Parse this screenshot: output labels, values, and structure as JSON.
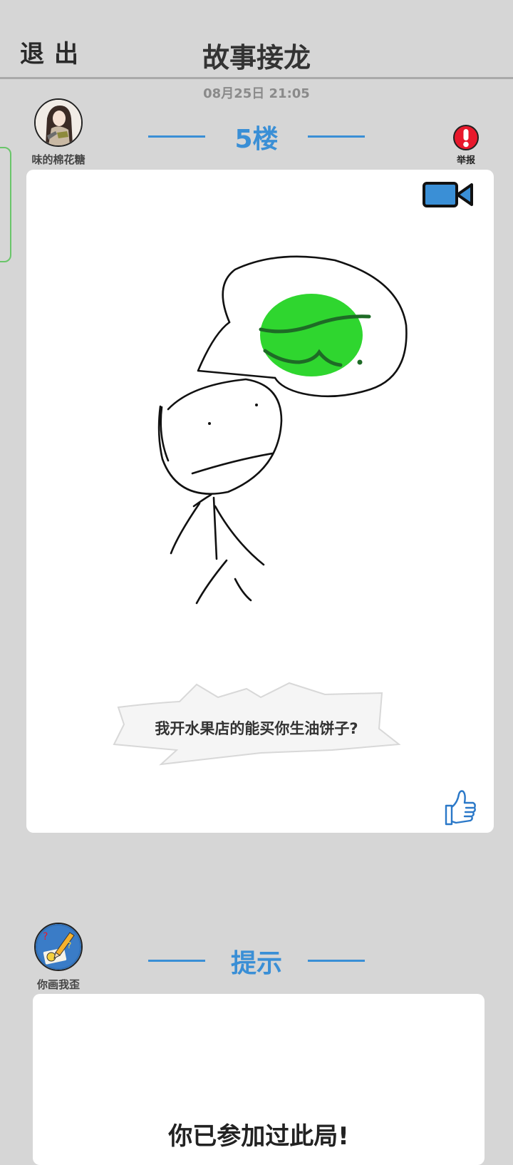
{
  "header": {
    "exit_label": "退出",
    "title": "故事接龙"
  },
  "post": {
    "time": "08月25日  21:05",
    "author_name": "味的棉花糖",
    "floor_label": "5楼",
    "report_label": "举报",
    "caption": "我开水果店的能买你生油饼子?"
  },
  "hint": {
    "author_name": "你画我歪",
    "label": "提示",
    "message": "你已参加过此局!"
  },
  "icons": {
    "report": "exclamation-circle-icon",
    "video": "video-camera-icon",
    "like": "thumbs-up-icon"
  },
  "colors": {
    "accent_blue": "#3a8fd6",
    "report_red": "#e8192c",
    "watermelon_green": "#2fd62f",
    "side_tab_green": "#6ac56a",
    "background": "#d6d6d6"
  }
}
